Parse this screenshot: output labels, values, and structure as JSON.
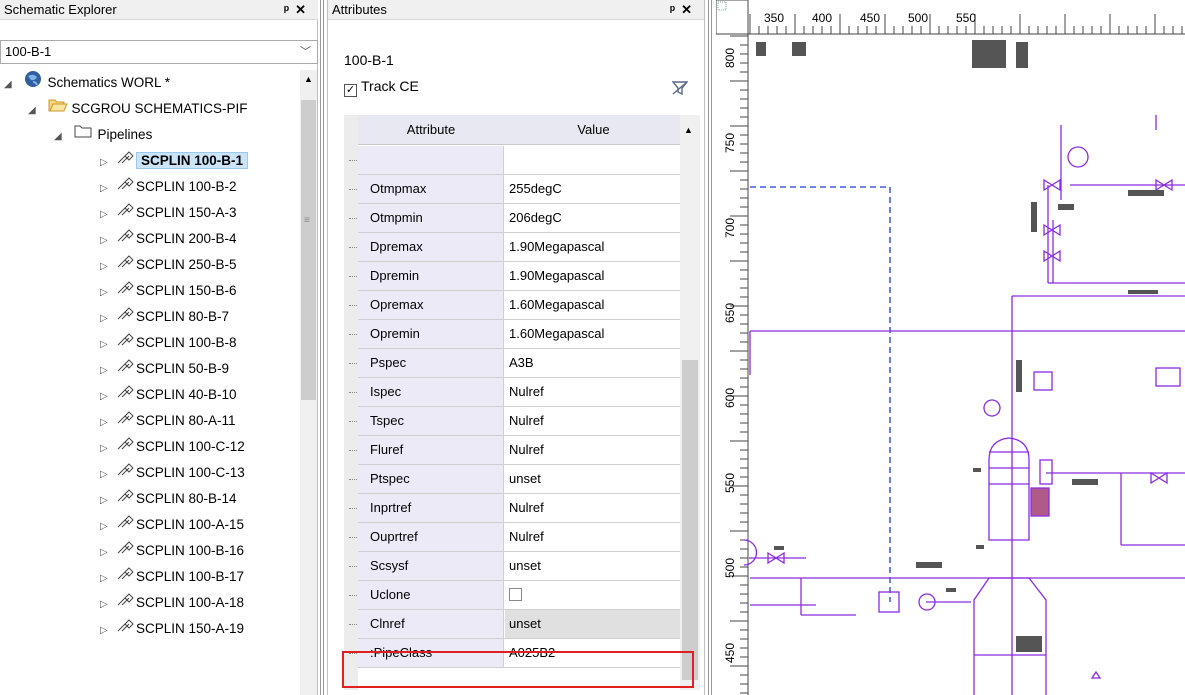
{
  "explorer": {
    "title": "Schematic Explorer",
    "pin": "ᵖ",
    "close": "✕",
    "combo_value": "100-B-1",
    "root": "Schematics WORL *",
    "group": "SCGROU SCHEMATICS-PIF",
    "pipelines": "Pipelines",
    "items": [
      "SCPLIN 100-B-1",
      "SCPLIN 100-B-2",
      "SCPLIN 150-A-3",
      "SCPLIN 200-B-4",
      "SCPLIN 250-B-5",
      "SCPLIN 150-B-6",
      "SCPLIN 80-B-7",
      "SCPLIN 100-B-8",
      "SCPLIN 50-B-9",
      "SCPLIN 40-B-10",
      "SCPLIN 80-A-11",
      "SCPLIN 100-C-12",
      "SCPLIN 100-C-13",
      "SCPLIN 80-B-14",
      "SCPLIN 100-A-15",
      "SCPLIN 100-B-16",
      "SCPLIN 100-B-17",
      "SCPLIN 100-A-18",
      "SCPLIN 150-A-19"
    ]
  },
  "attributes": {
    "title": "Attributes",
    "element": "100-B-1",
    "track_label": "Track CE",
    "track_checked": "✓",
    "col_attribute": "Attribute",
    "col_value": "Value",
    "rows": [
      {
        "name": "",
        "value": ""
      },
      {
        "name": "Otmpmax",
        "value": "255degC"
      },
      {
        "name": "Otmpmin",
        "value": "206degC"
      },
      {
        "name": "Dpremax",
        "value": "1.90Megapascal"
      },
      {
        "name": "Dpremin",
        "value": "1.90Megapascal"
      },
      {
        "name": "Opremax",
        "value": "1.60Megapascal"
      },
      {
        "name": "Opremin",
        "value": "1.60Megapascal"
      },
      {
        "name": "Pspec",
        "value": "A3B"
      },
      {
        "name": "Ispec",
        "value": "Nulref"
      },
      {
        "name": "Tspec",
        "value": "Nulref"
      },
      {
        "name": "Fluref",
        "value": "Nulref"
      },
      {
        "name": "Ptspec",
        "value": "unset"
      },
      {
        "name": "Inprtref",
        "value": "Nulref"
      },
      {
        "name": "Ouprtref",
        "value": "Nulref"
      },
      {
        "name": "Scsysf",
        "value": "unset"
      },
      {
        "name": "Uclone",
        "value": ""
      },
      {
        "name": "Clnref",
        "value": "unset"
      },
      {
        "name": ":PipeClass",
        "value": "A025B2"
      }
    ]
  },
  "drawing": {
    "ruler_top": [
      "350",
      "400",
      "450",
      "500",
      "550"
    ],
    "ruler_left": [
      "800",
      "750",
      "700",
      "650",
      "600",
      "550",
      "500",
      "450"
    ],
    "line_color": "#8a2be2",
    "dashed_color": "#1a3fd6",
    "highlight_color": "#e02020"
  }
}
